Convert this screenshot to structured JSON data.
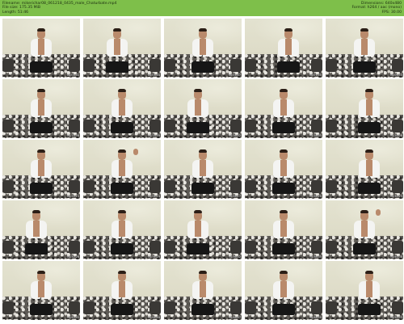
{
  "header": {
    "left": [
      "Filename: mikerichar08_061218_0435_male_Chaturbate.mp4",
      "File size: 175.35 MiB",
      "Length: 51:46"
    ],
    "right": [
      "Dimensions: 640x480",
      "Format: h264 / aac (mono)",
      "FPS: 30.00"
    ]
  },
  "thumbnails": [
    {
      "time": "00:01:41"
    },
    {
      "time": "00:03:44"
    },
    {
      "time": "00:05:47"
    },
    {
      "time": "00:07:50"
    },
    {
      "time": "00:09:53"
    },
    {
      "time": "00:11:56"
    },
    {
      "time": "00:13:59"
    },
    {
      "time": "00:16:02"
    },
    {
      "time": "00:18:05"
    },
    {
      "time": "00:20:08"
    },
    {
      "time": "00:22:11"
    },
    {
      "time": "00:24:14"
    },
    {
      "time": "00:26:17"
    },
    {
      "time": "00:28:20"
    },
    {
      "time": "00:30:23"
    },
    {
      "time": "00:32:26"
    },
    {
      "time": "00:34:29"
    },
    {
      "time": "00:36:32"
    },
    {
      "time": "00:38:35"
    },
    {
      "time": "00:40:38"
    },
    {
      "time": "00:42:41"
    },
    {
      "time": "00:44:44"
    },
    {
      "time": "00:46:47"
    },
    {
      "time": "00:48:50"
    },
    {
      "time": "00:50:53"
    }
  ]
}
